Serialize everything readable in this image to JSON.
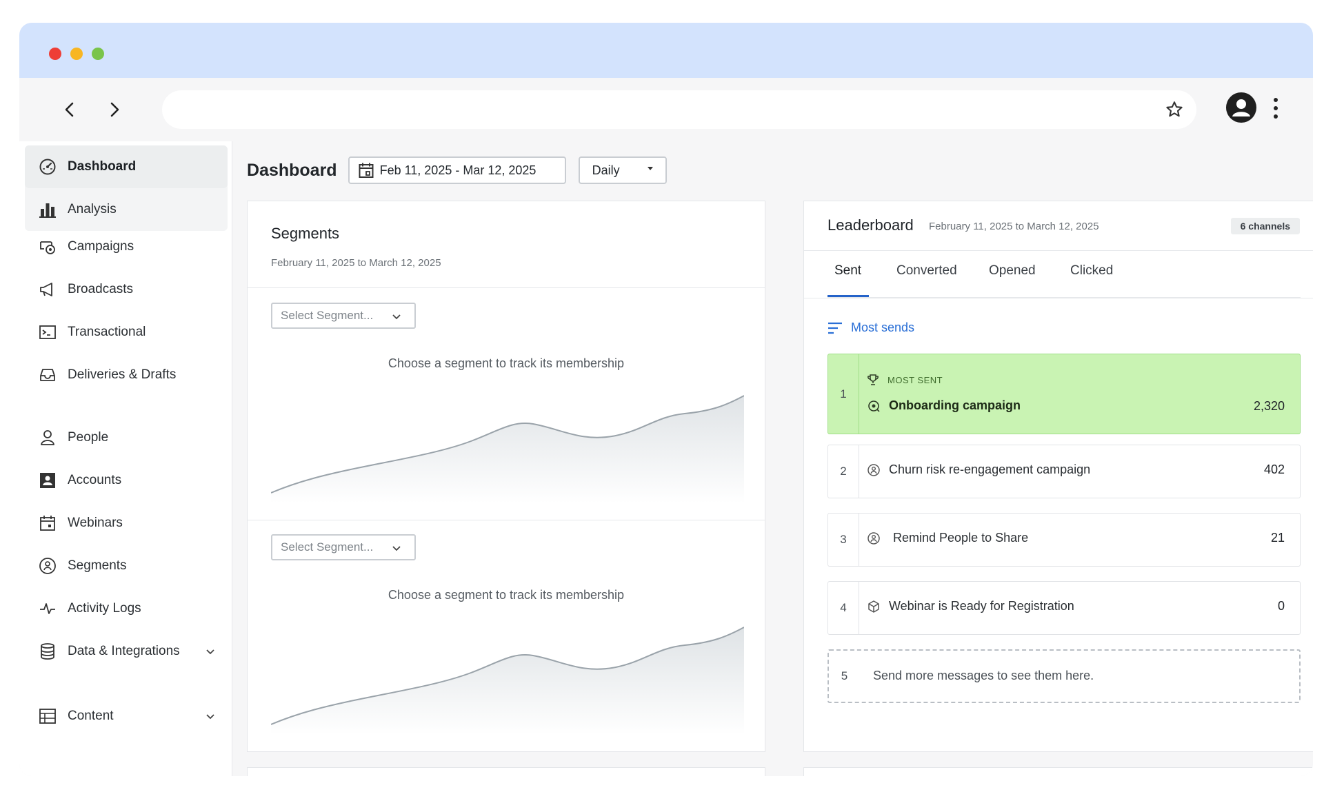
{
  "sidebar": {
    "top": [
      {
        "label": "Dashboard",
        "icon": "gauge-icon",
        "active": true
      },
      {
        "label": "Analysis",
        "icon": "bar-chart-icon",
        "active": false
      }
    ],
    "messaging": [
      {
        "label": "Campaigns",
        "icon": "campaign-icon"
      },
      {
        "label": "Broadcasts",
        "icon": "megaphone-icon"
      },
      {
        "label": "Transactional",
        "icon": "terminal-icon"
      },
      {
        "label": "Deliveries & Drafts",
        "icon": "inbox-icon"
      }
    ],
    "data": [
      {
        "label": "People",
        "icon": "person-icon"
      },
      {
        "label": "Accounts",
        "icon": "account-card-icon"
      },
      {
        "label": "Webinars",
        "icon": "calendar-icon"
      },
      {
        "label": "Segments",
        "icon": "segment-icon"
      },
      {
        "label": "Activity Logs",
        "icon": "pulse-icon"
      },
      {
        "label": "Data & Integrations",
        "icon": "database-icon"
      }
    ],
    "content": [
      {
        "label": "Content",
        "icon": "table-icon"
      }
    ]
  },
  "header": {
    "title": "Dashboard",
    "date_range": "Feb 11, 2025 - Mar 12, 2025",
    "interval": "Daily"
  },
  "segments": {
    "title": "Segments",
    "range": "February 11, 2025 to March 12, 2025",
    "select_placeholder": "Select Segment...",
    "hint": "Choose a segment to track its membership"
  },
  "leaderboard": {
    "title": "Leaderboard",
    "range": "February 11, 2025 to March 12, 2025",
    "badge": "6 channels",
    "tabs": [
      "Sent",
      "Converted",
      "Opened",
      "Clicked"
    ],
    "active_tab": "Sent",
    "sort_label": "Most sends",
    "most_sent_label": "MOST SENT",
    "rows": [
      {
        "rank": "1",
        "name": "Onboarding campaign",
        "value": "2,320"
      },
      {
        "rank": "2",
        "name": "Churn risk re-engagement campaign",
        "value": "402"
      },
      {
        "rank": "3",
        "name": "Remind People to Share",
        "value": "21"
      },
      {
        "rank": "4",
        "name": "Webinar is Ready for Registration",
        "value": "0"
      }
    ],
    "placeholder": {
      "rank": "5",
      "text": "Send more messages to see them here."
    }
  },
  "colors": {
    "accent": "#2a6fd6",
    "highlight": "#c9f3b3",
    "titlebar": "#d3e3fd"
  }
}
